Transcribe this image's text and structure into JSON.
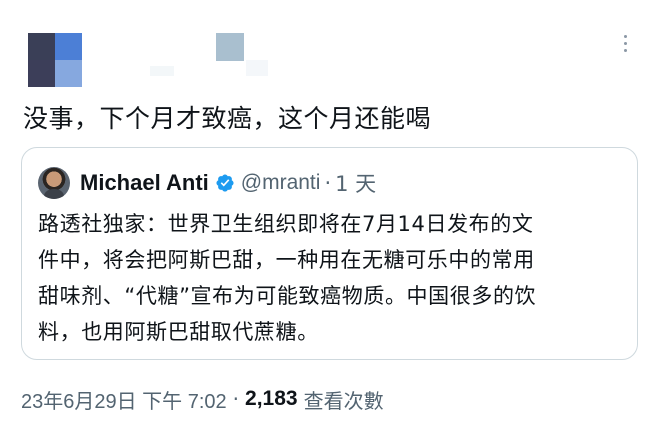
{
  "colors": {
    "text_primary": "#0f1419",
    "text_secondary": "#536471",
    "border": "#cfd9de",
    "verified_blue": "#1d9bf0"
  },
  "tweet": {
    "text": "没事，下个月才致癌，这个月还能喝",
    "more_icon": "more-vertical-icon"
  },
  "quote": {
    "author_name": "Michael Anti",
    "verified_icon": "verified-badge-icon",
    "handle": "@mranti",
    "separator": "·",
    "time": "1 天",
    "lines": [
      "路透社独家：世界卫生组织即将在7月14日发布的文",
      "件中，将会把阿斯巴甜，一种用在无糖可乐中的常用",
      "甜味剂、“代糖”宣布为可能致癌物质。中国很多的饮",
      "料，也用阿斯巴甜取代蔗糖。"
    ]
  },
  "meta": {
    "timestamp": "23年6月29日 下午 7:02",
    "separator": "·",
    "views_count": "2,183",
    "views_label": "查看次數"
  }
}
